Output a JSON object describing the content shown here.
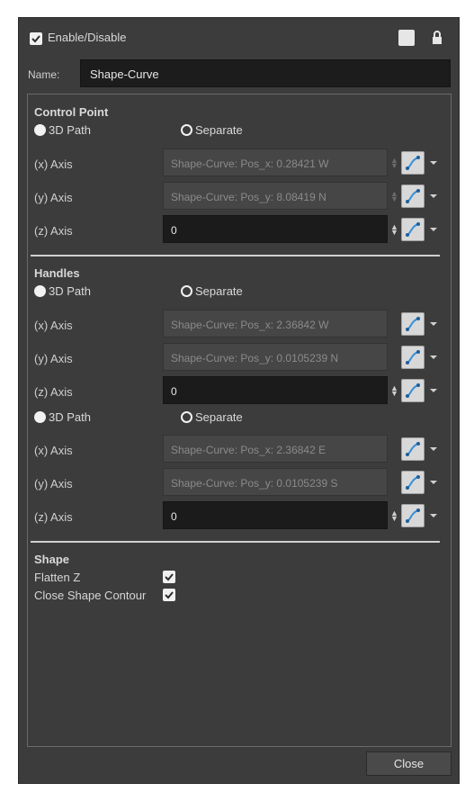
{
  "header": {
    "enable_label": "Enable/Disable",
    "enabled": true
  },
  "name": {
    "label": "Name:",
    "value": "Shape-Curve"
  },
  "control_point": {
    "title": "Control Point",
    "radio_3d": "3D Path",
    "radio_separate": "Separate",
    "x": {
      "label": "(x) Axis",
      "value": "Shape-Curve: Pos_x: 0.28421 W"
    },
    "y": {
      "label": "(y) Axis",
      "value": "Shape-Curve: Pos_y: 8.08419 N"
    },
    "z": {
      "label": "(z) Axis",
      "value": "0"
    }
  },
  "handles": {
    "title": "Handles",
    "group1": {
      "radio_3d": "3D Path",
      "radio_separate": "Separate",
      "x": {
        "label": "(x) Axis",
        "value": "Shape-Curve: Pos_x: 2.36842 W"
      },
      "y": {
        "label": "(y) Axis",
        "value": "Shape-Curve: Pos_y: 0.0105239 N"
      },
      "z": {
        "label": "(z) Axis",
        "value": "0"
      }
    },
    "group2": {
      "radio_3d": "3D Path",
      "radio_separate": "Separate",
      "x": {
        "label": "(x) Axis",
        "value": "Shape-Curve: Pos_x: 2.36842 E"
      },
      "y": {
        "label": "(y) Axis",
        "value": "Shape-Curve: Pos_y: 0.0105239 S"
      },
      "z": {
        "label": "(z) Axis",
        "value": "0"
      }
    }
  },
  "shape": {
    "title": "Shape",
    "flatten_label": "Flatten Z",
    "flatten_checked": true,
    "close_contour_label": "Close Shape Contour",
    "close_contour_checked": true
  },
  "footer": {
    "close_label": "Close"
  },
  "colors": {
    "background": "#3c3c3c",
    "field_active": "#1b1b1b",
    "field_linked": "#464646",
    "accent": "#3a8fd6"
  }
}
